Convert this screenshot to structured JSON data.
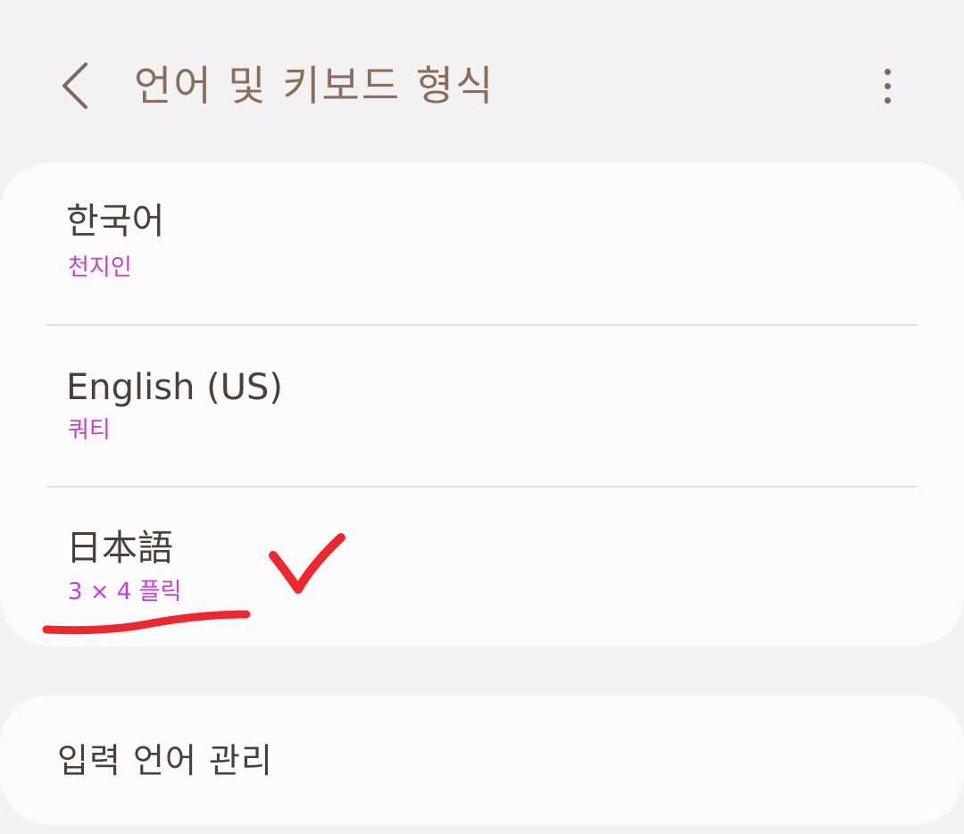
{
  "header": {
    "title": "언어 및 키보드 형식",
    "back_icon": "chevron-left-icon",
    "more_icon": "more-vertical-icon"
  },
  "languages": [
    {
      "name": "한국어",
      "keyboard": "천지인"
    },
    {
      "name": "English (US)",
      "keyboard": "쿼티"
    },
    {
      "name": "日本語",
      "keyboard": "3 × 4 플릭"
    }
  ],
  "manage": {
    "label": "입력 언어 관리"
  },
  "colors": {
    "background": "#f3f2f2",
    "card": "#fbfbfb",
    "title": "#8a6e5b",
    "subtitle_accent": "#c23fd8",
    "annotation": "#f0262f"
  }
}
